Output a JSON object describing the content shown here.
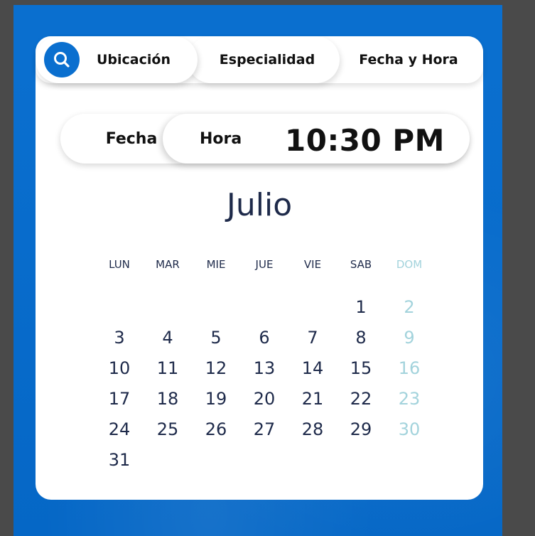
{
  "tabs": {
    "ubicacion": "Ubicación",
    "especialidad": "Especialidad",
    "fecha_hora": "Fecha y Hora"
  },
  "icons": {
    "search": "search-icon"
  },
  "switch": {
    "fecha_label": "Fecha",
    "hora_label": "Hora",
    "hora_value": "10:30 PM"
  },
  "calendar": {
    "month": "Julio",
    "weekdays": [
      "LUN",
      "MAR",
      "MIE",
      "JUE",
      "VIE",
      "SAB",
      "DOM"
    ],
    "weeks": [
      [
        "",
        "",
        "",
        "",
        "",
        "1",
        "2"
      ],
      [
        "3",
        "4",
        "5",
        "6",
        "7",
        "8",
        "9"
      ],
      [
        "10",
        "11",
        "12",
        "13",
        "14",
        "15",
        "16"
      ],
      [
        "17",
        "18",
        "19",
        "20",
        "21",
        "22",
        "23"
      ],
      [
        "24",
        "25",
        "26",
        "27",
        "28",
        "29",
        "30"
      ],
      [
        "31",
        "",
        "",
        "",
        "",
        "",
        ""
      ]
    ]
  },
  "colors": {
    "brand_blue": "#0a6fcf",
    "text_dark": "#1e2a4a",
    "sunday": "#a3d3dc"
  }
}
